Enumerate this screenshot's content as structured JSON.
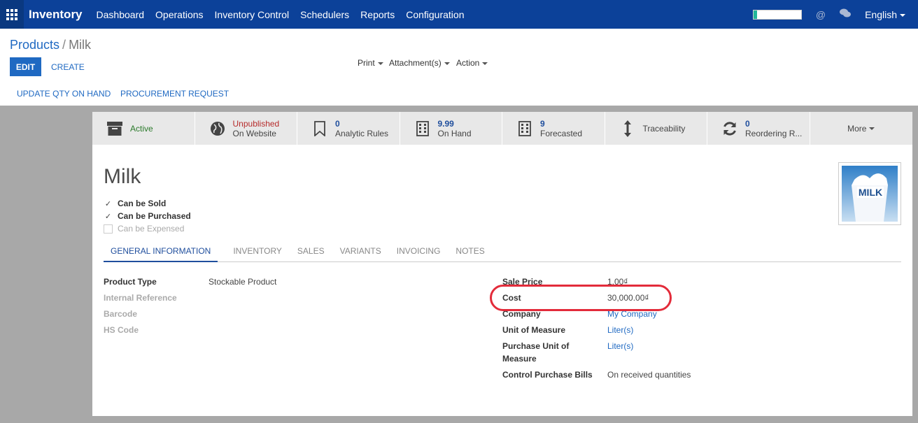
{
  "navbar": {
    "brand": "Inventory",
    "menu": [
      "Dashboard",
      "Operations",
      "Inventory Control",
      "Schedulers",
      "Reports",
      "Configuration"
    ],
    "language": "English",
    "progress_value": 0.08,
    "colors": {
      "bar": "#0c4199",
      "progress_fill": "#21b799"
    }
  },
  "control_panel": {
    "breadcrumb_parent": "Products",
    "breadcrumb_sep": "/",
    "breadcrumb_current": "Milk",
    "edit_label": "EDIT",
    "create_label": "CREATE",
    "print_label": "Print",
    "attachments_label": "Attachment(s)",
    "action_label": "Action"
  },
  "header_buttons": {
    "update_qty": "UPDATE QTY ON HAND",
    "procurement": "PROCUREMENT REQUEST"
  },
  "stat_buttons": [
    {
      "icon": "archive-icon",
      "line2": "Active"
    },
    {
      "icon": "globe-icon",
      "line1": "Unpublished",
      "line2": "On Website"
    },
    {
      "icon": "bookmark-icon",
      "line1": "0",
      "line2": "Analytic Rules"
    },
    {
      "icon": "building-icon",
      "line1": "9.99",
      "line2": "On Hand"
    },
    {
      "icon": "building-icon",
      "line1": "9",
      "line2": "Forecasted"
    },
    {
      "icon": "arrows-vertical-icon",
      "line2": "Traceability"
    },
    {
      "icon": "refresh-icon",
      "line1": "0",
      "line2": "Reordering R..."
    },
    {
      "line2": "More"
    }
  ],
  "product": {
    "name": "Milk",
    "can_be_sold": "Can be Sold",
    "can_be_purchased": "Can be Purchased",
    "can_be_expensed": "Can be Expensed",
    "image_text": "MILK"
  },
  "tabs": [
    "GENERAL INFORMATION",
    "INVENTORY",
    "SALES",
    "VARIANTS",
    "INVOICING",
    "NOTES"
  ],
  "fields_left": {
    "product_type_label": "Product Type",
    "product_type_value": "Stockable Product",
    "internal_ref_label": "Internal Reference",
    "barcode_label": "Barcode",
    "hs_code_label": "HS Code"
  },
  "fields_right": {
    "sale_price_label": "Sale Price",
    "sale_price_value": "1.00₫",
    "cost_label": "Cost",
    "cost_value": "30,000.00₫",
    "company_label": "Company",
    "company_value": "My Company",
    "uom_label": "Unit of Measure",
    "uom_value": "Liter(s)",
    "purchase_uom_label_1": "Purchase Unit of",
    "purchase_uom_label_2": "Measure",
    "purchase_uom_value": "Liter(s)",
    "control_bills_label": "Control Purchase Bills",
    "control_bills_value": "On received quantities"
  }
}
